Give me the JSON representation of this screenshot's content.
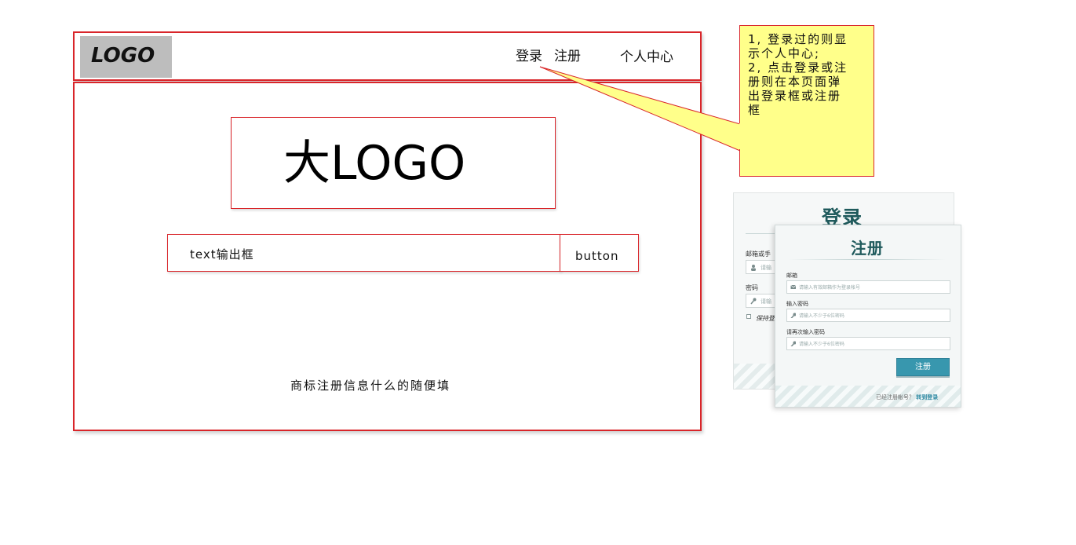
{
  "header": {
    "logo": "LOGO",
    "nav_login": "登录",
    "nav_register": "注册",
    "nav_profile": "个人中心"
  },
  "main": {
    "big_logo": "大LOGO",
    "text_output": "text输出框",
    "button": "button",
    "footer_note": "商标注册信息什么的随便填"
  },
  "callout": {
    "lines": [
      "1, 登录过的则显",
      "示个人中心;",
      "2, 点击登录或注",
      "册则在本页面弹",
      "出登录框或注册",
      "框"
    ],
    "color": "#ffff8a"
  },
  "login_dialog": {
    "title": "登录",
    "account_label": "邮箱或手",
    "account_placeholder": "请输",
    "password_label": "密码",
    "password_placeholder": "请输",
    "remember": "保持登"
  },
  "register_dialog": {
    "title": "注册",
    "email_label": "邮箱",
    "email_placeholder": "请输入有效邮箱作为登录帐号",
    "password_label": "输入密码",
    "password_placeholder": "请输入不少于6位密码",
    "confirm_label": "请再次输入密码",
    "confirm_placeholder": "请输入不少于6位密码",
    "submit": "注册",
    "footer_text": "已经注册帐号？",
    "footer_link": "转到登录",
    "accent": "#3897ae"
  },
  "frame_color": "#d9252a"
}
